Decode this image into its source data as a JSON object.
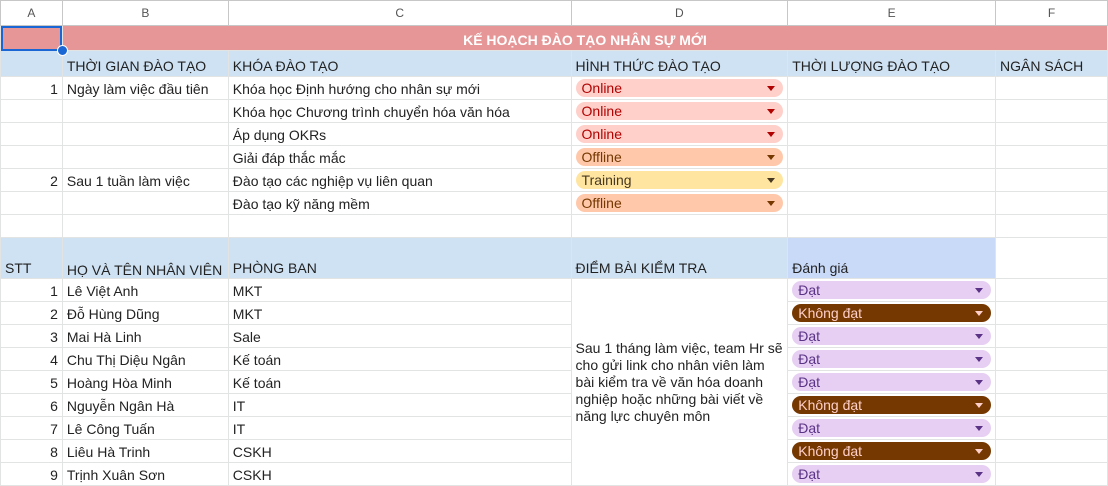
{
  "columns": [
    "A",
    "B",
    "C",
    "D",
    "E",
    "F"
  ],
  "title": "KẾ HOẠCH ĐÀO TẠO NHÂN SỰ MỚI",
  "plan_headers": [
    "",
    "THỜI GIAN ĐÀO TẠO",
    "KHÓA ĐÀO TẠO",
    "HÌNH THỨC ĐÀO TẠO",
    "THỜI LƯỢNG ĐÀO TẠO",
    "NGÂN SÁCH"
  ],
  "plan_rows": [
    {
      "no": "1",
      "time": "Ngày làm việc đầu tiên",
      "course": "Khóa học Định hướng cho nhân sự mới",
      "format": "Online"
    },
    {
      "no": "",
      "time": "",
      "course": "Khóa học Chương trình chuyển hóa văn hóa",
      "format": "Online"
    },
    {
      "no": "",
      "time": "",
      "course": "Áp dụng OKRs",
      "format": "Online"
    },
    {
      "no": "",
      "time": "",
      "course": "Giải đáp thắc mắc",
      "format": "Offline"
    },
    {
      "no": "2",
      "time": "Sau 1 tuần làm việc",
      "course": "Đào tạo các nghiệp vụ liên quan",
      "format": "Training"
    },
    {
      "no": "",
      "time": "",
      "course": "Đào tạo kỹ năng mềm",
      "format": "Offline"
    }
  ],
  "staff_headers": [
    "STT",
    "HỌ VÀ TÊN NHÂN VIÊN",
    "PHÒNG BAN",
    "ĐIỂM BÀI KIỂM TRA",
    "Đánh giá"
  ],
  "test_note": "Sau  1 tháng làm việc, team Hr sẽ cho gửi link cho nhân viên làm bài kiểm tra về văn hóa doanh nghiệp hoặc những bài viết về năng lực chuyên môn",
  "staff_rows": [
    {
      "no": "1",
      "name": "Lê Việt Anh",
      "dept": "MKT",
      "eval": "Đạt"
    },
    {
      "no": "2",
      "name": "Đỗ Hùng Dũng",
      "dept": "MKT",
      "eval": "Không đạt"
    },
    {
      "no": "3",
      "name": "Mai Hà Linh",
      "dept": "Sale",
      "eval": "Đạt"
    },
    {
      "no": "4",
      "name": "Chu Thị Diệu Ngân",
      "dept": "Kế toán",
      "eval": "Đạt"
    },
    {
      "no": "5",
      "name": "Hoàng Hòa Minh",
      "dept": "Kế toán",
      "eval": "Đạt"
    },
    {
      "no": "6",
      "name": "Nguyễn Ngân Hà",
      "dept": "IT",
      "eval": "Không đạt"
    },
    {
      "no": "7",
      "name": "Lê Công Tuấn",
      "dept": "IT",
      "eval": "Đạt"
    },
    {
      "no": "8",
      "name": "Liêu Hà Trinh",
      "dept": "CSKH",
      "eval": "Không đạt"
    },
    {
      "no": "9",
      "name": "Trịnh Xuân Sơn",
      "dept": "CSKH",
      "eval": "Đạt"
    }
  ],
  "chip_colors": {
    "Online": {
      "bg": "#ffcfc9",
      "fg": "#b10202"
    },
    "Offline": {
      "bg": "#ffc8aa",
      "fg": "#753800"
    },
    "Training": {
      "bg": "#ffe5a0",
      "fg": "#473821"
    },
    "Đạt": {
      "bg": "#e6cff2",
      "fg": "#5a3286"
    },
    "Không đạt": {
      "bg": "#753800",
      "fg": "#ffcfc9"
    }
  }
}
